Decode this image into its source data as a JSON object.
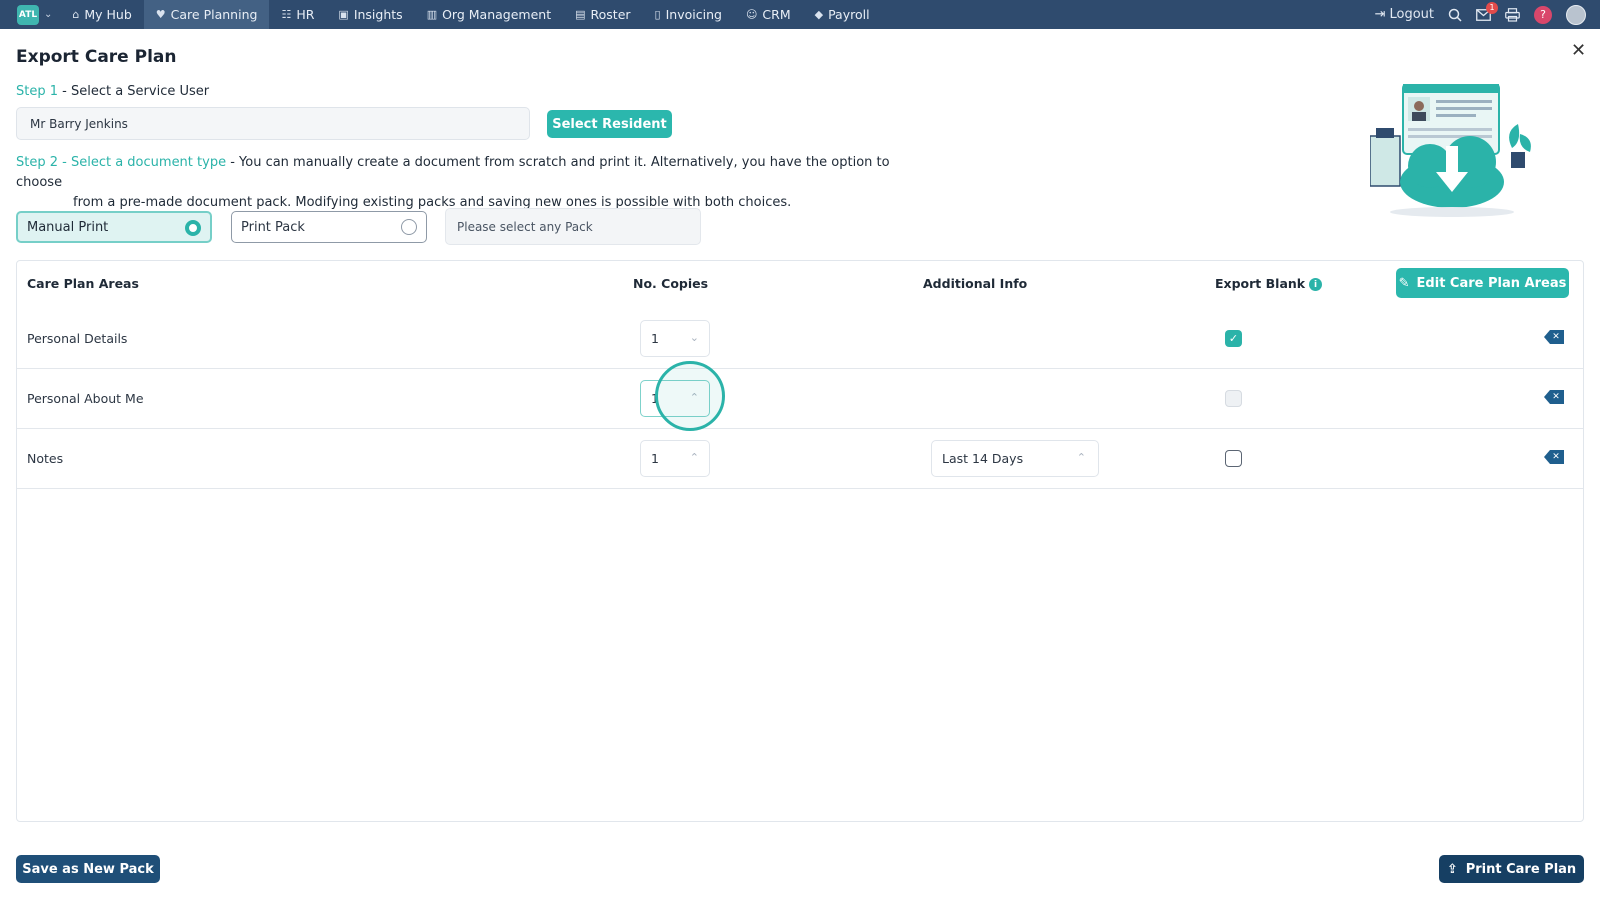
{
  "nav": {
    "logo": "ATL",
    "items": [
      {
        "label": "My Hub",
        "icon": "home-icon",
        "glyph": "⌂"
      },
      {
        "label": "Care Planning",
        "icon": "heart-icon",
        "glyph": "♥",
        "active": true
      },
      {
        "label": "HR",
        "icon": "users-icon",
        "glyph": "☷"
      },
      {
        "label": "Insights",
        "icon": "chart-icon",
        "glyph": "▣"
      },
      {
        "label": "Org Management",
        "icon": "building-icon",
        "glyph": "▥"
      },
      {
        "label": "Roster",
        "icon": "calendar-icon",
        "glyph": "▤"
      },
      {
        "label": "Invoicing",
        "icon": "file-icon",
        "glyph": "▯"
      },
      {
        "label": "CRM",
        "icon": "user-icon",
        "glyph": "☺"
      },
      {
        "label": "Payroll",
        "icon": "tag-icon",
        "glyph": "◆"
      }
    ],
    "logout": "Logout",
    "mail_badge": "1",
    "help": "?"
  },
  "title": "Export Care Plan",
  "step1": {
    "label": "Step 1",
    "text": " - Select a Service User"
  },
  "resident_value": "Mr Barry Jenkins",
  "select_resident": "Select Resident",
  "step2": {
    "label": "Step 2",
    "sub": " - Select a document type",
    "text": " - You can manually create a document from scratch and print it. Alternatively, you have the option to choose",
    "text2": "from a pre-made document pack. Modifying existing packs and saving new ones is possible with both choices."
  },
  "doc_type": {
    "manual": "Manual Print",
    "pack": "Print Pack",
    "pack_placeholder": "Please select any Pack"
  },
  "table": {
    "headers": {
      "areas": "Care Plan Areas",
      "copies": "No. Copies",
      "additional": "Additional Info",
      "export_blank": "Export Blank"
    },
    "edit_button": "Edit Care Plan Areas",
    "rows": [
      {
        "name": "Personal Details",
        "copies": "1",
        "additional": "",
        "export_blank": "checked"
      },
      {
        "name": "Personal About Me",
        "copies": "1",
        "additional": "",
        "export_blank": "disabled"
      },
      {
        "name": "Notes",
        "copies": "1",
        "additional": "Last 14 Days",
        "export_blank": "empty"
      }
    ]
  },
  "footer": {
    "save": "Save as New Pack",
    "print": "Print Care Plan"
  },
  "colors": {
    "accent": "#2bb3a9",
    "nav": "#2f4b6e",
    "dark_button": "#1f4f78"
  }
}
